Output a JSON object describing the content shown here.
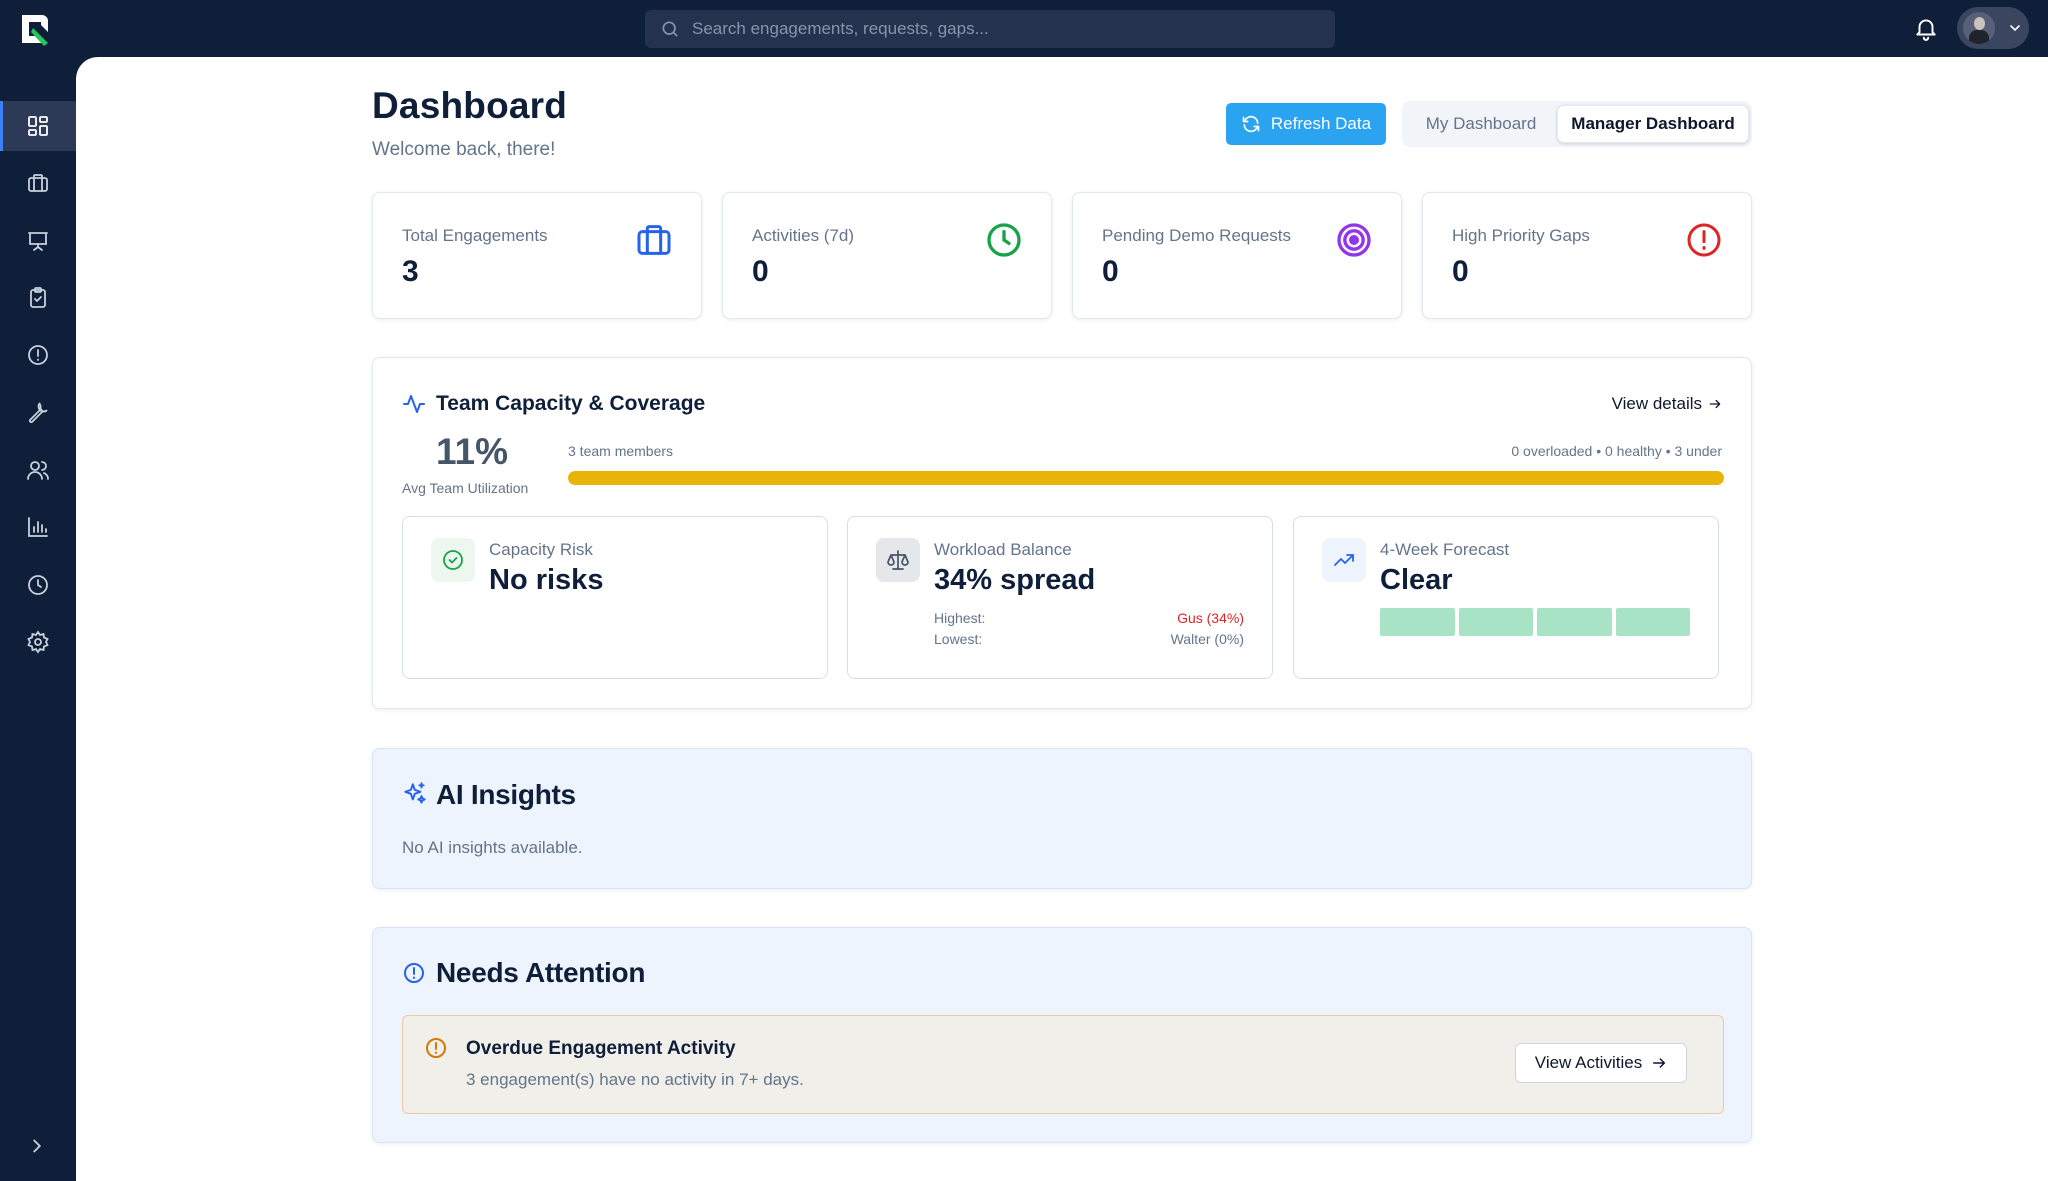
{
  "topbar": {
    "search_placeholder": "Search engagements, requests, gaps..."
  },
  "sidebar": {
    "items": [
      {
        "icon": "dashboard-icon",
        "active": true
      },
      {
        "icon": "briefcase-icon",
        "active": false
      },
      {
        "icon": "presentation-icon",
        "active": false
      },
      {
        "icon": "clipboard-check-icon",
        "active": false
      },
      {
        "icon": "alert-circle-icon",
        "active": false
      },
      {
        "icon": "wrench-icon",
        "active": false
      },
      {
        "icon": "users-icon",
        "active": false
      },
      {
        "icon": "bar-chart-icon",
        "active": false
      },
      {
        "icon": "clock-icon",
        "active": false
      },
      {
        "icon": "settings-icon",
        "active": false
      }
    ]
  },
  "header": {
    "title": "Dashboard",
    "subtitle": "Welcome back, there!",
    "refresh_label": "Refresh Data",
    "toggle": {
      "my": "My Dashboard",
      "manager": "Manager Dashboard",
      "selected": "Manager Dashboard"
    }
  },
  "stats": [
    {
      "label": "Total Engagements",
      "value": "3",
      "icon": "briefcase-icon",
      "color": "#2563eb"
    },
    {
      "label": "Activities (7d)",
      "value": "0",
      "icon": "clock-icon",
      "color": "#16a34a"
    },
    {
      "label": "Pending Demo Requests",
      "value": "0",
      "icon": "target-icon",
      "color": "#9333ea"
    },
    {
      "label": "High Priority Gaps",
      "value": "0",
      "icon": "alert-circle-icon",
      "color": "#dc2626"
    }
  ],
  "capacity": {
    "title": "Team Capacity & Coverage",
    "view_details": "View details",
    "utilization": "11%",
    "utilization_label": "Avg Team Utilization",
    "team_members": "3 team members",
    "status": "0 overloaded • 0 healthy • 3 under",
    "bar_fill_pct": 100,
    "bar_color": "#eab308",
    "risk": {
      "label": "Capacity Risk",
      "value": "No risks"
    },
    "balance": {
      "label": "Workload Balance",
      "value": "34% spread",
      "highest_label": "Highest:",
      "highest_value": "Gus (34%)",
      "lowest_label": "Lowest:",
      "lowest_value": "Walter (0%)"
    },
    "forecast": {
      "label": "4-Week Forecast",
      "value": "Clear",
      "weeks": 4,
      "color": "#a7e3c4"
    }
  },
  "ai": {
    "title": "AI Insights",
    "text": "No AI insights available."
  },
  "attention": {
    "title": "Needs Attention",
    "alert_title": "Overdue Engagement Activity",
    "alert_text": "3 engagement(s) have no activity in 7+ days.",
    "button": "View Activities"
  }
}
